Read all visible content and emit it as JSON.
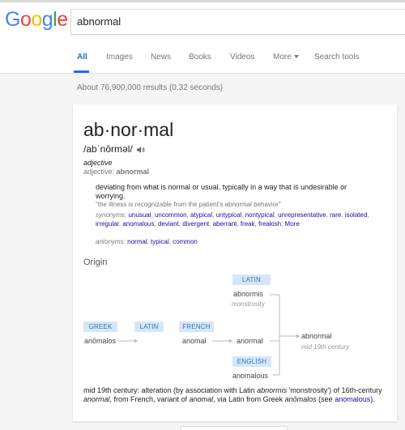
{
  "header": {
    "logo_letters": [
      {
        "ch": "G",
        "color": "#4285F4"
      },
      {
        "ch": "o",
        "color": "#EA4335"
      },
      {
        "ch": "o",
        "color": "#FBBC05"
      },
      {
        "ch": "g",
        "color": "#4285F4"
      },
      {
        "ch": "l",
        "color": "#34A853"
      },
      {
        "ch": "e",
        "color": "#EA4335"
      }
    ],
    "search_value": "abnormal"
  },
  "tabs": [
    "All",
    "Images",
    "News",
    "Books",
    "Videos",
    "More",
    "Search tools"
  ],
  "results_stats": "About 76,900,000 results (0.32 seconds)",
  "dictionary": {
    "word": "ab·nor·mal",
    "pronunciation": "/abˈnôrməl/",
    "part_of_speech": "adjective",
    "form_label": "adjective:",
    "form_word": "abnormal",
    "definition": "deviating from what is normal or usual, typically in a way that is undesirable or worrying.",
    "example": "\"the illness is recognizable from the patient's abnormal behavior\"",
    "synonyms_label": "synonyms:",
    "synonyms": [
      "unusual",
      "uncommon",
      "atypical",
      "untypical",
      "nontypical",
      "unrepresentative",
      "rare",
      "isolated",
      "irregular",
      "anomalous",
      "deviant",
      "divergent",
      "aberrant",
      "freak",
      "freakish"
    ],
    "more_label": "More",
    "antonyms_label": "antonyms:",
    "antonyms": [
      "normal",
      "typical",
      "common"
    ]
  },
  "origin": {
    "title": "Origin",
    "tags": {
      "latin": "LATIN",
      "greek": "GREEK",
      "latin2": "LATIN",
      "french": "FRENCH",
      "english": "ENGLISH"
    },
    "words": {
      "abnormis": "abnormis",
      "monstrosity": "monstrosity",
      "anomalos": "anōmalos",
      "anomal": "anomal",
      "anormal": "anormal",
      "abnormal": "abnormal",
      "century": "mid 19th century",
      "anomalous": "anomalous"
    },
    "note_parts": {
      "p1": "mid 19th century: alteration (by association with Latin ",
      "i1": "abnormis",
      "p2": " 'monstrosity') of 16th-century ",
      "i2": "anormal",
      "p3": ", from French, variant of ",
      "i3": "anomal",
      "p4": ", via Latin from Greek ",
      "i4": "anōmalos",
      "p5": " (see ",
      "link": "anomalous",
      "p6": ")."
    }
  },
  "colors": {
    "accent": "#1a73e8",
    "link": "#1a0dab",
    "tag_bg": "#d4e7f8",
    "tag_text": "#3d73ad"
  }
}
